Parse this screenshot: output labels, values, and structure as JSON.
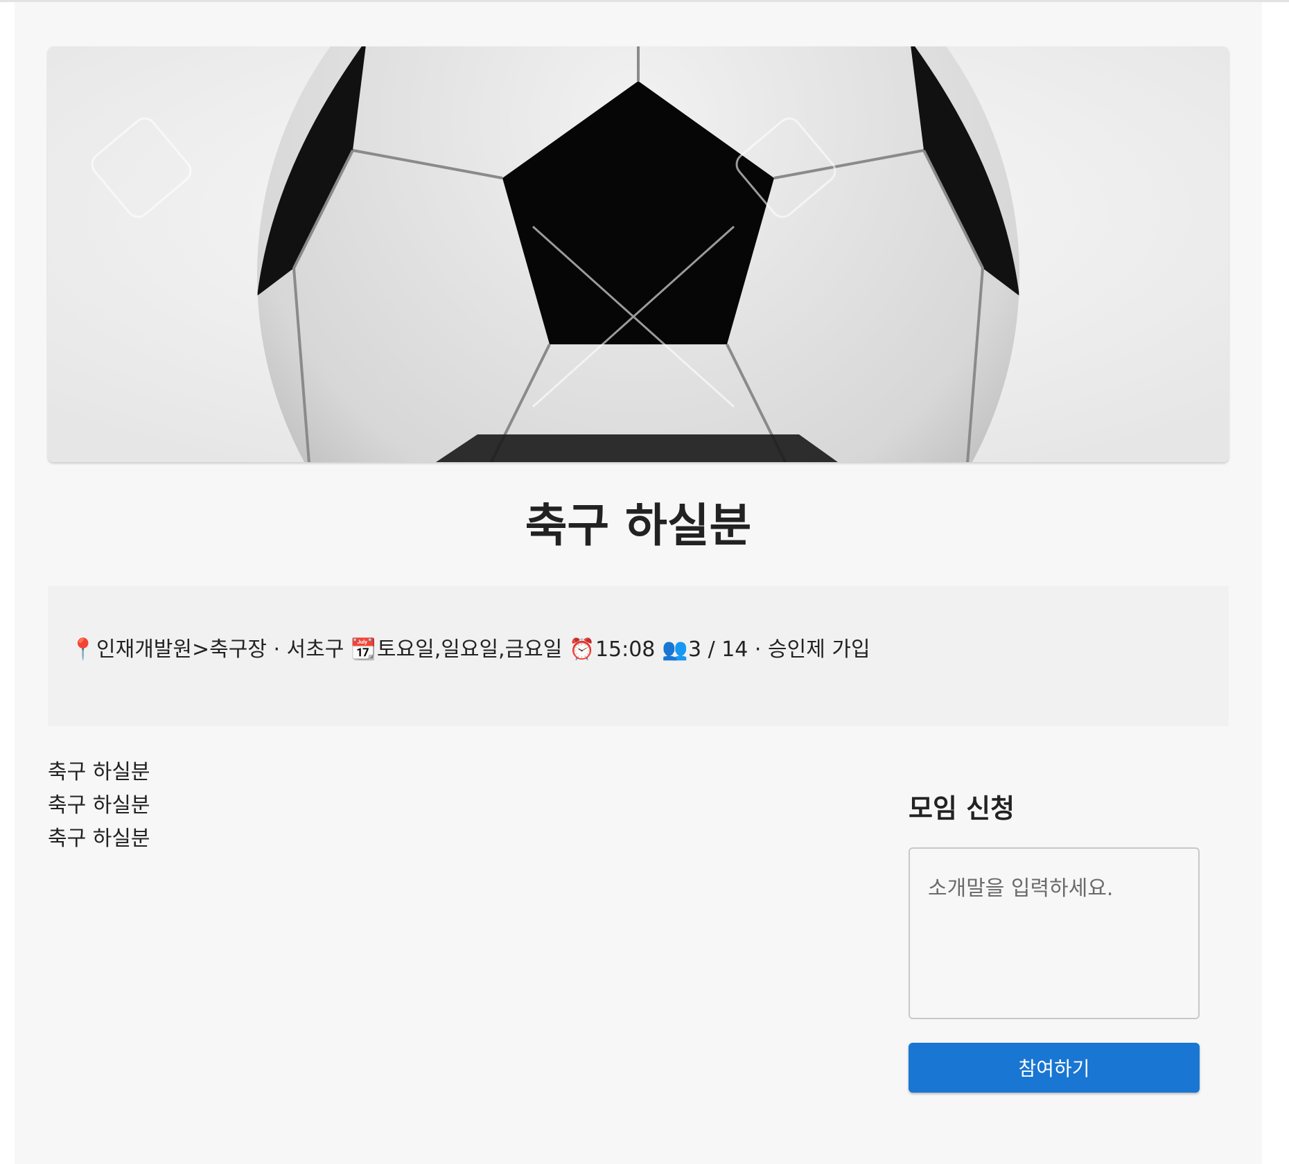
{
  "meeting": {
    "title": "축구 하실분",
    "hero_image": "soccer-ball-photo"
  },
  "info": {
    "location_icon": "📍",
    "location": "인재개발원>축구장 · 서초구",
    "days_icon": "📆",
    "days": "토요일,일요일,금요일",
    "time_icon": "⏰",
    "time": "15:08",
    "members_icon": "👥",
    "members": "3 / 14 · 승인제 가입"
  },
  "description": {
    "lines": [
      "축구 하실분",
      "축구 하실분",
      "축구 하실분"
    ]
  },
  "apply": {
    "title": "모임 신청",
    "placeholder": "소개말을 입력하세요.",
    "button_label": "참여하기",
    "button_color": "#1976d2"
  }
}
